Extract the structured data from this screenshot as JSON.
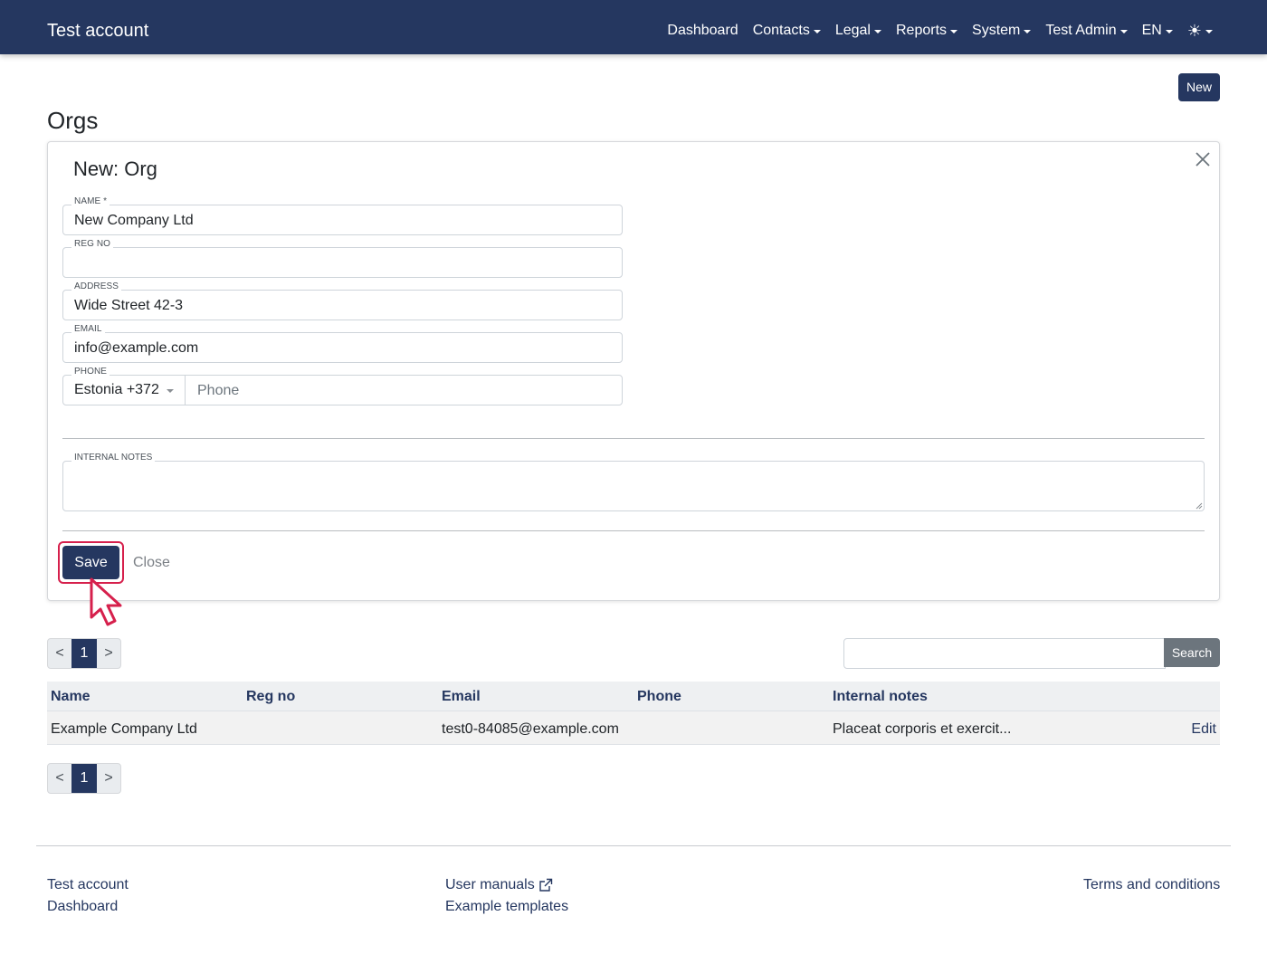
{
  "navbar": {
    "brand": "Test account",
    "items": [
      {
        "label": "Dashboard",
        "dropdown": false
      },
      {
        "label": "Contacts",
        "dropdown": true
      },
      {
        "label": "Legal",
        "dropdown": true
      },
      {
        "label": "Reports",
        "dropdown": true
      },
      {
        "label": "System",
        "dropdown": true
      },
      {
        "label": "Test Admin",
        "dropdown": true
      },
      {
        "label": "EN",
        "dropdown": true
      }
    ],
    "theme_icon": "sun-icon",
    "theme_glyph": "☀"
  },
  "toolbar": {
    "new_label": "New"
  },
  "page": {
    "title": "Orgs"
  },
  "form": {
    "title": "New: Org",
    "name": {
      "label": "NAME *",
      "value": "New Company Ltd"
    },
    "reg_no": {
      "label": "REG NO",
      "value": ""
    },
    "address": {
      "label": "ADDRESS",
      "value": "Wide Street 42-3"
    },
    "email": {
      "label": "EMAIL",
      "value": "info@example.com"
    },
    "phone": {
      "label": "PHONE",
      "country": "Estonia +372",
      "placeholder": "Phone",
      "value": ""
    },
    "internal_notes": {
      "label": "INTERNAL NOTES",
      "value": ""
    },
    "save_label": "Save",
    "close_label": "Close"
  },
  "pagination": {
    "prev": "<",
    "current": "1",
    "next": ">"
  },
  "search": {
    "button_label": "Search",
    "value": ""
  },
  "table": {
    "columns": [
      "Name",
      "Reg no",
      "Email",
      "Phone",
      "Internal notes"
    ],
    "rows": [
      {
        "name": "Example Company Ltd",
        "reg_no": "",
        "email": "test0-84085@example.com",
        "phone": "",
        "internal_notes": "Placeat corporis et exercit...",
        "action": "Edit"
      }
    ]
  },
  "footer": {
    "col1": [
      "Test account",
      "Dashboard"
    ],
    "col2": [
      "User manuals",
      "Example templates"
    ],
    "col3": [
      "Terms and conditions"
    ]
  },
  "colors": {
    "primary": "#253760",
    "highlight": "#d6204c",
    "secondary": "#6c757d"
  }
}
